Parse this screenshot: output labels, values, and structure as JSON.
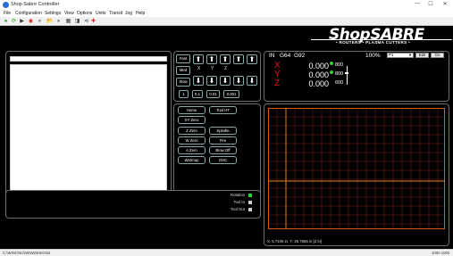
{
  "window": {
    "title": "Shop Sabre Controller",
    "minimize": "—",
    "maximize": "☐",
    "close": "✕"
  },
  "menu": [
    "File",
    "Configuration",
    "Settings",
    "View",
    "Options",
    "Units",
    "Transit",
    "Jog",
    "Help"
  ],
  "toolbar": [
    "●",
    "⟳",
    "▶",
    "◉",
    "⏸",
    "📂",
    "⏸",
    "▦",
    "◨",
    "⊲",
    "✚"
  ],
  "logo": {
    "brand": "ShopSABRE",
    "tagline": "• ROUTERS • PLASMA CUTTERS •"
  },
  "jog": {
    "modes": [
      "Fast",
      "Med",
      "Slow"
    ],
    "axes": [
      "X",
      "Y",
      "Z"
    ],
    "steps": [
      "1",
      "0.1",
      "0.01",
      "0.001"
    ],
    "up_arrow": "⬆",
    "down_arrow": "⬇"
  },
  "commands": [
    [
      "Home",
      "Tool HT"
    ],
    [
      "XY Zero",
      ""
    ],
    [
      "Z Zero",
      "Spindle"
    ],
    [
      "W Zero",
      "Fire"
    ],
    [
      "A Zero",
      "Blow Off"
    ],
    [
      "Warmup",
      "OSC"
    ]
  ],
  "dro": {
    "units": "IN",
    "g1": "G64",
    "g2": "G92",
    "percent": "100%",
    "program": "P1",
    "edit_label": "Edit",
    "go_label": "Go",
    "axes": [
      {
        "axis": "X",
        "value": "0.000",
        "speed": "800"
      },
      {
        "axis": "Y",
        "value": "0.000",
        "speed": "800"
      },
      {
        "axis": "Z",
        "value": "0.000",
        "speed": "600"
      }
    ]
  },
  "status": {
    "items": [
      {
        "label": "Rotation",
        "color": "#2fd12f"
      },
      {
        "label": "Tool In",
        "color": "#cfcfcf"
      },
      {
        "label": "Tool Out",
        "color": "#cfcfcf"
      }
    ]
  },
  "plot": {
    "coords": "X: 5.7106 in,  Y: 25.7566 in  [Z in]"
  },
  "statusbar": {
    "path": "C:\\WINCNC\\NEWDESIGN2",
    "right": "1000  1000"
  }
}
